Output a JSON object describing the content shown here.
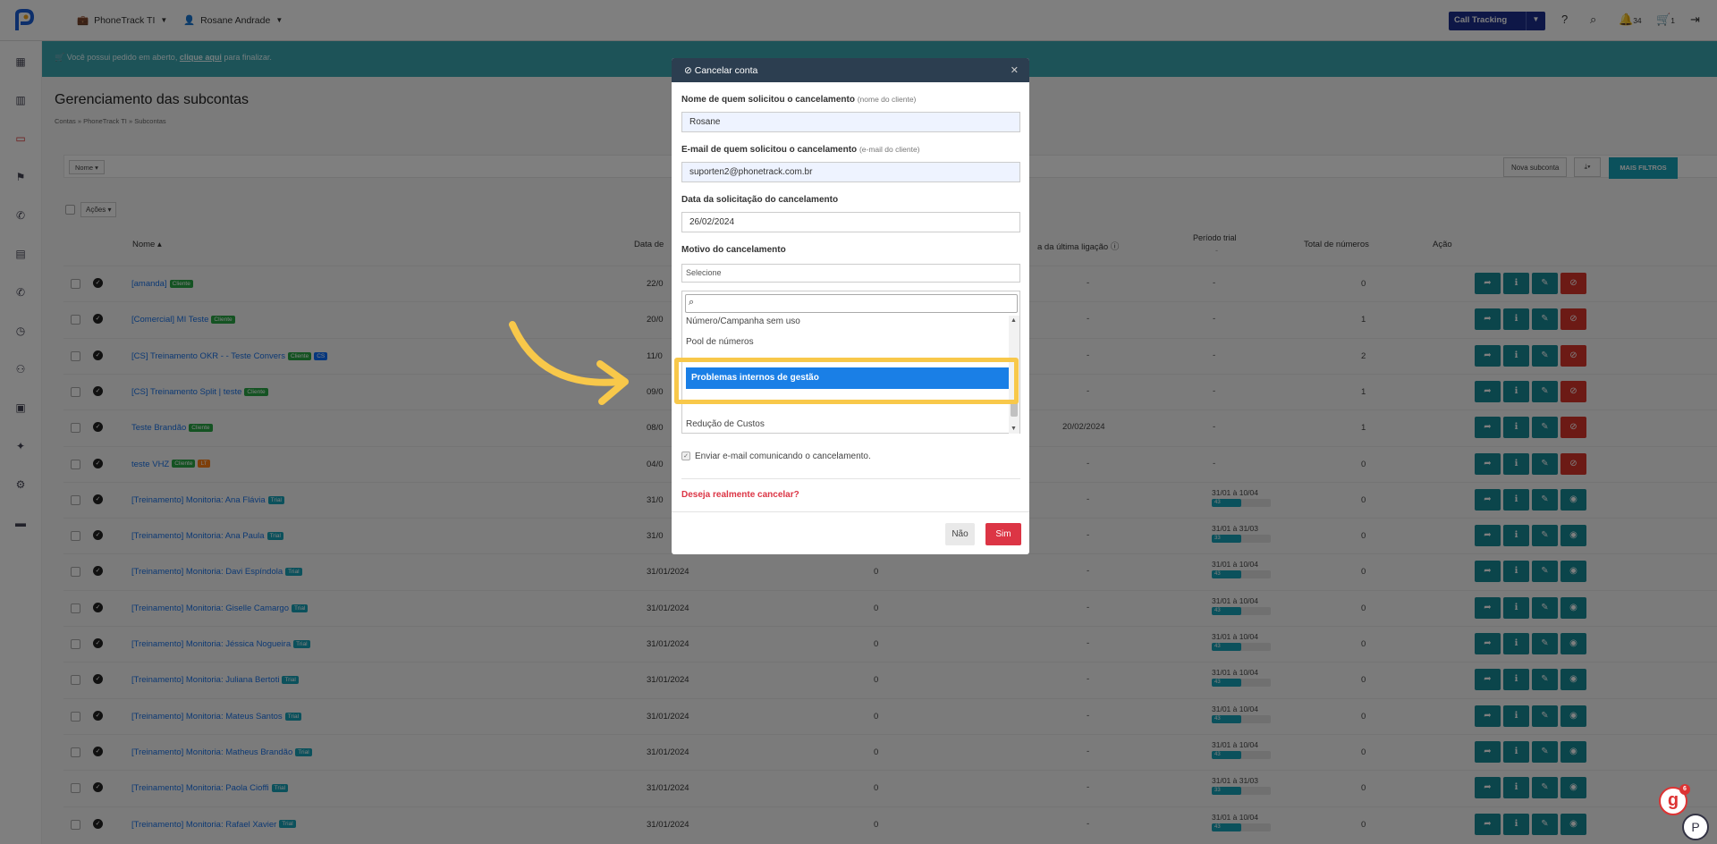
{
  "topbar": {
    "company": "PhoneTrack TI",
    "user": "Rosane Andrade",
    "product": "Call Tracking",
    "notif_count": "34",
    "cart_count": "1"
  },
  "banner": {
    "pre": "Você possui pedido em aberto, ",
    "link": "clique aqui",
    "post": " para finalizar."
  },
  "page": {
    "title": "Gerenciamento das subcontas",
    "breadcrumb": "Contas  »  PhoneTrack TI  »  Subcontas"
  },
  "filters": {
    "nome_label": "Nome",
    "acoes_label": "Ações",
    "nova_subconta": "Nova subconta",
    "mais_filtros": "MAIS FILTROS"
  },
  "table": {
    "headers": {
      "nome": "Nome",
      "data": "Data de",
      "ultima": "a da última ligação",
      "trial": "Período trial",
      "trial_sub": "-",
      "total": "Total de números",
      "acao": "Ação"
    },
    "rows": [
      {
        "name": "[amanda]",
        "badges": [
          {
            "t": "Cliente",
            "c": "cli"
          }
        ],
        "date": "22/0",
        "zero": "",
        "last": "-",
        "trial": "-",
        "total": "0",
        "red": true
      },
      {
        "name": "[Comercial] MI Teste",
        "badges": [
          {
            "t": "Cliente",
            "c": "cli"
          }
        ],
        "date": "20/0",
        "zero": "",
        "last": "-",
        "trial": "-",
        "total": "1",
        "red": true
      },
      {
        "name": "[CS] Treinamento OKR - - Teste Convers",
        "badges": [
          {
            "t": "Cliente",
            "c": "cli"
          },
          {
            "t": "CS",
            "c": "cs"
          }
        ],
        "date": "11/0",
        "zero": "",
        "last": "-",
        "trial": "-",
        "total": "2",
        "red": true
      },
      {
        "name": "[CS] Treinamento Split | teste",
        "badges": [
          {
            "t": "Cliente",
            "c": "cli"
          }
        ],
        "date": "09/0",
        "zero": "",
        "last": "-",
        "trial": "-",
        "total": "1",
        "red": true
      },
      {
        "name": "Teste Brandão",
        "badges": [
          {
            "t": "Cliente",
            "c": "cli"
          }
        ],
        "date": "08/0",
        "zero": "",
        "last": "20/02/2024",
        "trial": "-",
        "total": "1",
        "red": true
      },
      {
        "name": "teste VHZ",
        "badges": [
          {
            "t": "Cliente",
            "c": "cli"
          },
          {
            "t": "LT",
            "c": "lt"
          }
        ],
        "date": "04/0",
        "zero": "",
        "last": "-",
        "trial": "-",
        "total": "0",
        "red": true
      },
      {
        "name": "[Treinamento] Monitoria: Ana Flávia",
        "badges": [
          {
            "t": "Trial",
            "c": "trial"
          }
        ],
        "date": "31/0",
        "zero": "",
        "last": "-",
        "trial_range": "31/01 à 10/04",
        "trial_days": "43",
        "trial_frac": 0.5,
        "total": "0",
        "red": false
      },
      {
        "name": "[Treinamento] Monitoria: Ana Paula",
        "badges": [
          {
            "t": "Trial",
            "c": "trial"
          }
        ],
        "date": "31/0",
        "zero": "",
        "last": "-",
        "trial_range": "31/01 à 31/03",
        "trial_days": "33",
        "trial_frac": 0.5,
        "total": "0",
        "red": false
      },
      {
        "name": "[Treinamento] Monitoria: Davi Espíndola",
        "badges": [
          {
            "t": "Trial",
            "c": "trial"
          }
        ],
        "date": "31/01/2024",
        "zero": "0",
        "last": "-",
        "trial_range": "31/01 à 10/04",
        "trial_days": "43",
        "trial_frac": 0.5,
        "total": "0",
        "red": false
      },
      {
        "name": "[Treinamento] Monitoria: Giselle Camargo",
        "badges": [
          {
            "t": "Trial",
            "c": "trial"
          }
        ],
        "date": "31/01/2024",
        "zero": "0",
        "last": "-",
        "trial_range": "31/01 à 10/04",
        "trial_days": "43",
        "trial_frac": 0.5,
        "total": "0",
        "red": false
      },
      {
        "name": "[Treinamento] Monitoria: Jéssica Nogueira",
        "badges": [
          {
            "t": "Trial",
            "c": "trial"
          }
        ],
        "date": "31/01/2024",
        "zero": "0",
        "last": "-",
        "trial_range": "31/01 à 10/04",
        "trial_days": "43",
        "trial_frac": 0.5,
        "total": "0",
        "red": false
      },
      {
        "name": "[Treinamento] Monitoria: Juliana Bertoti",
        "badges": [
          {
            "t": "Trial",
            "c": "trial"
          }
        ],
        "date": "31/01/2024",
        "zero": "0",
        "last": "-",
        "trial_range": "31/01 à 10/04",
        "trial_days": "43",
        "trial_frac": 0.5,
        "total": "0",
        "red": false
      },
      {
        "name": "[Treinamento] Monitoria: Mateus Santos",
        "badges": [
          {
            "t": "Trial",
            "c": "trial"
          }
        ],
        "date": "31/01/2024",
        "zero": "0",
        "last": "-",
        "trial_range": "31/01 à 10/04",
        "trial_days": "43",
        "trial_frac": 0.5,
        "total": "0",
        "red": false
      },
      {
        "name": "[Treinamento] Monitoria: Matheus Brandão",
        "badges": [
          {
            "t": "Trial",
            "c": "trial"
          }
        ],
        "date": "31/01/2024",
        "zero": "0",
        "last": "-",
        "trial_range": "31/01 à 10/04",
        "trial_days": "43",
        "trial_frac": 0.5,
        "total": "0",
        "red": false
      },
      {
        "name": "[Treinamento] Monitoria: Paola Cioffi",
        "badges": [
          {
            "t": "Trial",
            "c": "trial"
          }
        ],
        "date": "31/01/2024",
        "zero": "0",
        "last": "-",
        "trial_range": "31/01 à 31/03",
        "trial_days": "33",
        "trial_frac": 0.5,
        "total": "0",
        "red": false
      },
      {
        "name": "[Treinamento] Monitoria: Rafael Xavier",
        "badges": [
          {
            "t": "Trial",
            "c": "trial"
          }
        ],
        "date": "31/01/2024",
        "zero": "0",
        "last": "-",
        "trial_range": "31/01 à 10/04",
        "trial_days": "43",
        "trial_frac": 0.5,
        "total": "0",
        "red": false
      }
    ]
  },
  "modal": {
    "title": "Cancelar conta",
    "name_label": "Nome de quem solicitou o cancelamento",
    "name_hint": "(nome do cliente)",
    "name_value": "Rosane",
    "email_label": "E-mail de quem solicitou o cancelamento",
    "email_hint": "(e-mail do cliente)",
    "email_value": "suporten2@phonetrack.com.br",
    "date_label": "Data da solicitação do cancelamento",
    "date_value": "26/02/2024",
    "reason_label": "Motivo do cancelamento",
    "reason_placeholder": "Selecione",
    "options": [
      "Número/Campanha sem uso",
      "Pool de números",
      "Problemas internos de gestão",
      "Redução de Custos"
    ],
    "highlighted": "Problemas internos de gestão",
    "send_email": "Enviar e-mail comunicando o cancelamento.",
    "confirm_q": "Deseja realmente cancelar?",
    "no": "Não",
    "yes": "Sim"
  },
  "colors": {
    "accent": "#17a2b8",
    "danger": "#dc3545",
    "highlight": "#f8c84a",
    "select": "#1a7fe6"
  }
}
